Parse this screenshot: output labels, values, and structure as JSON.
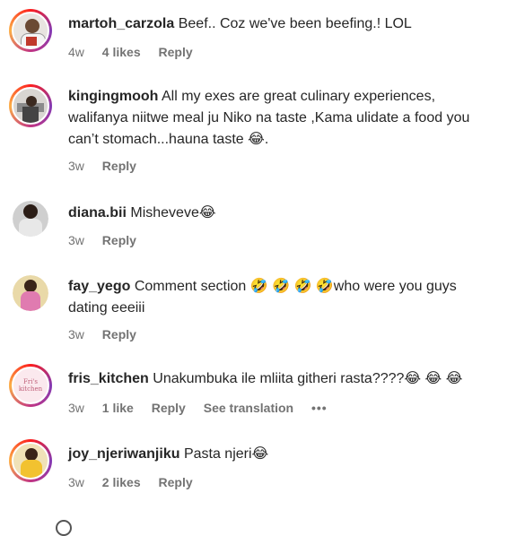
{
  "comments": [
    {
      "username": "martoh_carzola",
      "text": "Beef.. Coz we've been beefing.! LOL",
      "time": "4w",
      "likes": "4 likes",
      "reply": "Reply"
    },
    {
      "username": "kingingmooh",
      "text": "All my exes are great culinary experiences, walifanya niitwe meal ju Niko na taste ,Kama ulidate a food you can’t stomach...hauna taste 😂.",
      "time": "3w",
      "reply": "Reply"
    },
    {
      "username": "diana.bii",
      "text": "Misheveve😂",
      "time": "3w",
      "reply": "Reply"
    },
    {
      "username": "fay_yego",
      "text": "Comment section 🤣 🤣 🤣 🤣who were you guys dating eeeiii",
      "time": "3w",
      "reply": "Reply"
    },
    {
      "username": "fris_kitchen",
      "text": "Unakumbuka ile mliita githeri rasta????😂 😂 😂",
      "time": "3w",
      "likes": "1 like",
      "reply": "Reply",
      "see_translation": "See translation",
      "more": "•••",
      "avatar_text": "Fri's kitchen"
    },
    {
      "username": "joy_njeriwanjiku",
      "text": "Pasta njeri😂",
      "time": "3w",
      "likes": "2 likes",
      "reply": "Reply"
    }
  ],
  "colors": {
    "text": "#262626",
    "muted": "#737373",
    "story_ring": "#c13584"
  }
}
